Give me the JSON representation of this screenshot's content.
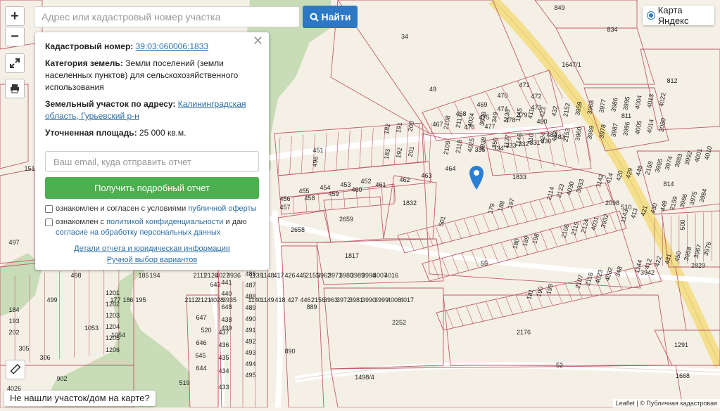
{
  "search": {
    "placeholder": "Адрес или кадастровый номер участка",
    "button_label": "Найти"
  },
  "map_controls": {
    "zoom_in": "+",
    "zoom_out": "−"
  },
  "layer_switch": {
    "label": "Карта Яндекс"
  },
  "info_panel": {
    "cadastral_label": "Кадастровый номер:",
    "cadastral_value": "39:03:060006:1833",
    "category_label": "Категория земель:",
    "category_value": " Земли поселений (земли населенных пунктов) для сельскохозяйственного использования",
    "address_label": "Земельный участок по адресу:",
    "address_value": "Калининградская область, Гурьевский р-н",
    "area_label": "Уточненная площадь:",
    "area_value": " 25 000 кв.м.",
    "email_placeholder": "Ваш email, куда отправить отчет",
    "get_report_button": "Получить подробный отчет",
    "consent_1_text": "ознакомлен и согласен с условиями ",
    "consent_1_link": "публичной оферты",
    "consent_2_text": "ознакомлен с ",
    "consent_2_link": "политикой конфиденциальности",
    "consent_2_text2": " и даю",
    "consent_2_link2": "согласие на обработку персональных данных",
    "details_link": "Детали отчета и юридическая информация",
    "manual_link": "Ручной выбор вариантов"
  },
  "bottom": {
    "not_found": "Не нашли участок/дом на карте?"
  },
  "attribution": "Leaflet | © Публичная кадастровая",
  "parcel_labels": [
    "849",
    "34",
    "834",
    "49",
    "470",
    "471",
    "472",
    "473",
    "812",
    "469",
    "474",
    "475",
    "476",
    "477",
    "478",
    "479",
    "480",
    "484",
    "811",
    "467",
    "468",
    "451",
    "335",
    "334",
    "333",
    "332",
    "331",
    "330",
    "483",
    "1833",
    "814",
    "496",
    "497",
    "498",
    "499",
    "500",
    "501",
    "464",
    "463",
    "462",
    "461",
    "460",
    "459",
    "458",
    "457",
    "456",
    "455",
    "454",
    "453",
    "452",
    "1832",
    "2659",
    "2658",
    "1817",
    "55",
    "2098",
    "3942",
    "889",
    "890",
    "2252",
    "2176",
    "52",
    "1291",
    "1668",
    "2829",
    "510",
    "1647/1",
    "1498/4",
    "643",
    "486",
    "487",
    "488",
    "489",
    "490",
    "491",
    "492",
    "493",
    "494",
    "495",
    "177",
    "178",
    "179",
    "180",
    "181",
    "182",
    "183",
    "184",
    "185",
    "186",
    "187",
    "188",
    "189",
    "190",
    "191",
    "192",
    "193",
    "194",
    "195",
    "196",
    "197",
    "198",
    "199",
    "200",
    "201",
    "202",
    "520",
    "519",
    "644",
    "645",
    "646",
    "647",
    "648",
    "433",
    "434",
    "435",
    "436",
    "437",
    "438",
    "439",
    "440",
    "441",
    "1206",
    "1205",
    "1204",
    "1203",
    "1202",
    "1201",
    "2106",
    "2107",
    "2108",
    "2109",
    "2110",
    "2111",
    "2112",
    "2113",
    "2114",
    "2115",
    "2116",
    "2117",
    "2118",
    "2119",
    "2120",
    "2121",
    "2122",
    "2123",
    "2124",
    "4023",
    "4024",
    "4025",
    "4026",
    "4027",
    "4028",
    "4029",
    "4030",
    "4031",
    "4032",
    "3939",
    "3938",
    "3937",
    "3936",
    "3935",
    "3934",
    "3933",
    "3932",
    "348",
    "349",
    "350",
    "351",
    "1053",
    "1054",
    "305",
    "306",
    "902",
    "151",
    "1136",
    "1137",
    "1138",
    "1139",
    "1140",
    "1141",
    "1142",
    "1143",
    "1144",
    "1145",
    "1146",
    "1147",
    "1148",
    "1149",
    "415",
    "414",
    "413",
    "412",
    "411",
    "410",
    "416",
    "417",
    "418",
    "419",
    "420",
    "421",
    "422",
    "423",
    "424",
    "425",
    "426",
    "427",
    "428",
    "429",
    "430",
    "431",
    "432",
    "443",
    "444",
    "445",
    "446",
    "447",
    "448",
    "449",
    "450",
    "2152",
    "2153",
    "2154",
    "2155",
    "2156",
    "2157",
    "2158",
    "2159",
    "3958",
    "3959",
    "3960",
    "3961",
    "3962",
    "3963",
    "3964",
    "3965",
    "3966",
    "3967",
    "3968",
    "3969",
    "3970",
    "3971",
    "3972",
    "3973",
    "3974",
    "3975",
    "3976",
    "3977",
    "3978",
    "3979",
    "3980",
    "3981",
    "3982",
    "3983",
    "3984",
    "3985",
    "3986",
    "3987",
    "3988",
    "3989",
    "3990",
    "3991",
    "3992",
    "3993",
    "3994",
    "3995",
    "3996",
    "3997",
    "3998",
    "3999",
    "4000",
    "4001",
    "4002",
    "4003",
    "4004",
    "4005",
    "4006",
    "4007",
    "4008",
    "4009",
    "4010",
    "4011",
    "4012",
    "4013",
    "4014",
    "4015",
    "4016",
    "4017",
    "4018",
    "4019",
    "4020",
    "4021",
    "4022",
    "2080"
  ]
}
